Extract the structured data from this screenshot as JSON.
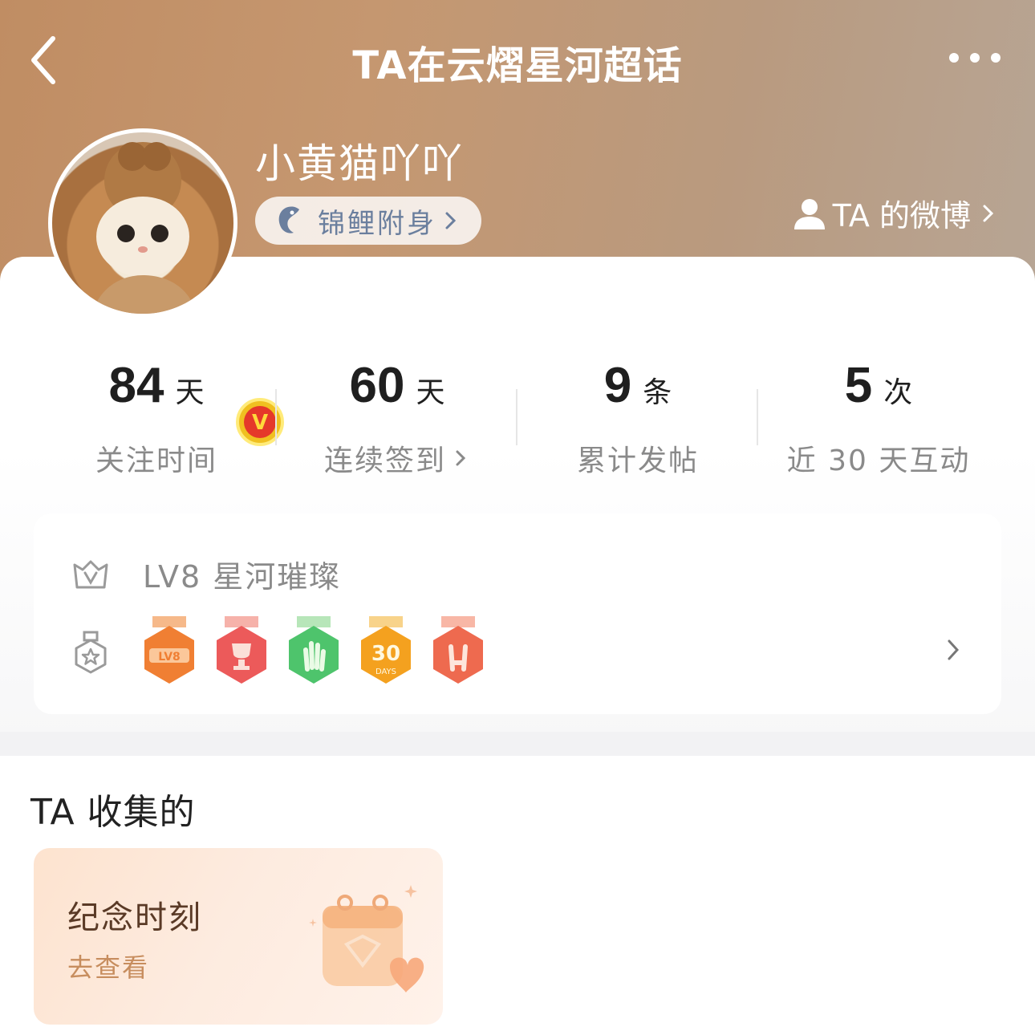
{
  "header": {
    "title": "TA在云熠星河超话",
    "back_icon": "chevron-left-icon",
    "more_icon": "more-dots-icon",
    "username": "小黄猫吖吖",
    "koi_tag": {
      "label": "锦鲤附身",
      "icon": "koi-fish-icon"
    },
    "ta_weibo": {
      "label": "TA 的微博",
      "icon": "person-icon"
    }
  },
  "avatar": {
    "badge": "V",
    "badge_color": "#f0c020"
  },
  "stats": [
    {
      "value": "84",
      "unit": "天",
      "label": "关注时间",
      "has_arrow": false
    },
    {
      "value": "60",
      "unit": "天",
      "label": "连续签到",
      "has_arrow": true
    },
    {
      "value": "9",
      "unit": "条",
      "label": "累计发帖",
      "has_arrow": false
    },
    {
      "value": "5",
      "unit": "次",
      "label": "近 30 天互动",
      "has_arrow": false
    }
  ],
  "level": {
    "text": "LV8  星河璀璨",
    "badges": [
      {
        "name": "lv8-badge",
        "text": "LV8",
        "color": "#f07f33"
      },
      {
        "name": "trophy-badge",
        "text": "",
        "color": "#ec5a5a"
      },
      {
        "name": "hand-badge",
        "text": "",
        "color": "#4ec46c"
      },
      {
        "name": "30-days-badge",
        "text": "30 DAYS",
        "color": "#f4a11f"
      },
      {
        "name": "rock-hand-badge",
        "text": "",
        "color": "#ee6a4f"
      }
    ]
  },
  "collection": {
    "title": "TA 收集的",
    "card": {
      "title": "纪念时刻",
      "subtitle": "去查看"
    }
  },
  "colors": {
    "header_start": "#c08d63",
    "header_end": "#b7a594",
    "accent": "#c78d5e"
  }
}
